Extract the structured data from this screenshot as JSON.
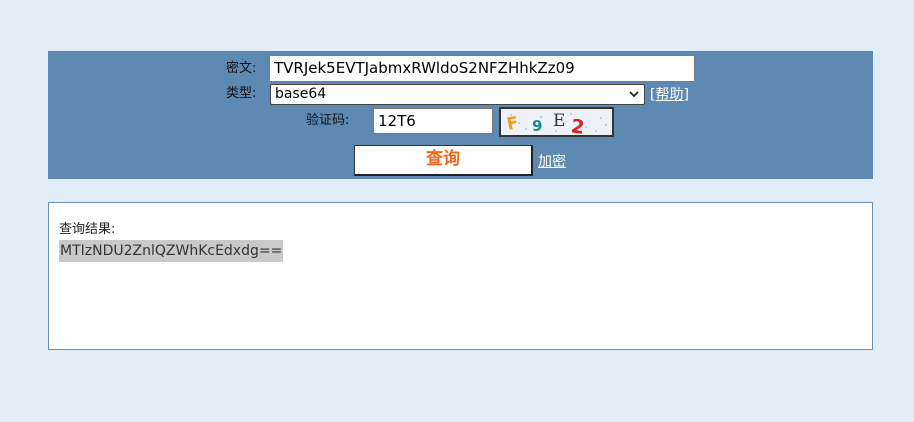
{
  "form": {
    "ciphertext_label": "密文:",
    "ciphertext_value": "TVRJek5EVTJabmxRWldoS2NFZHhkZz09",
    "type_label": "类型:",
    "type_value": "base64",
    "help_link": "[帮助]",
    "captcha_label": "验证码:",
    "captcha_value": "12T6",
    "captcha_chars": [
      "F",
      "9",
      "E",
      "2"
    ],
    "query_button": "查询",
    "encrypt_link": "加密"
  },
  "result": {
    "label": "查询结果:",
    "value": "MTIzNDU2ZnlQZWhKcEdxdg=="
  },
  "colors": {
    "background": "#e2eef7",
    "panel": "#5d89b3",
    "query_button_text": "#f06a1c"
  }
}
